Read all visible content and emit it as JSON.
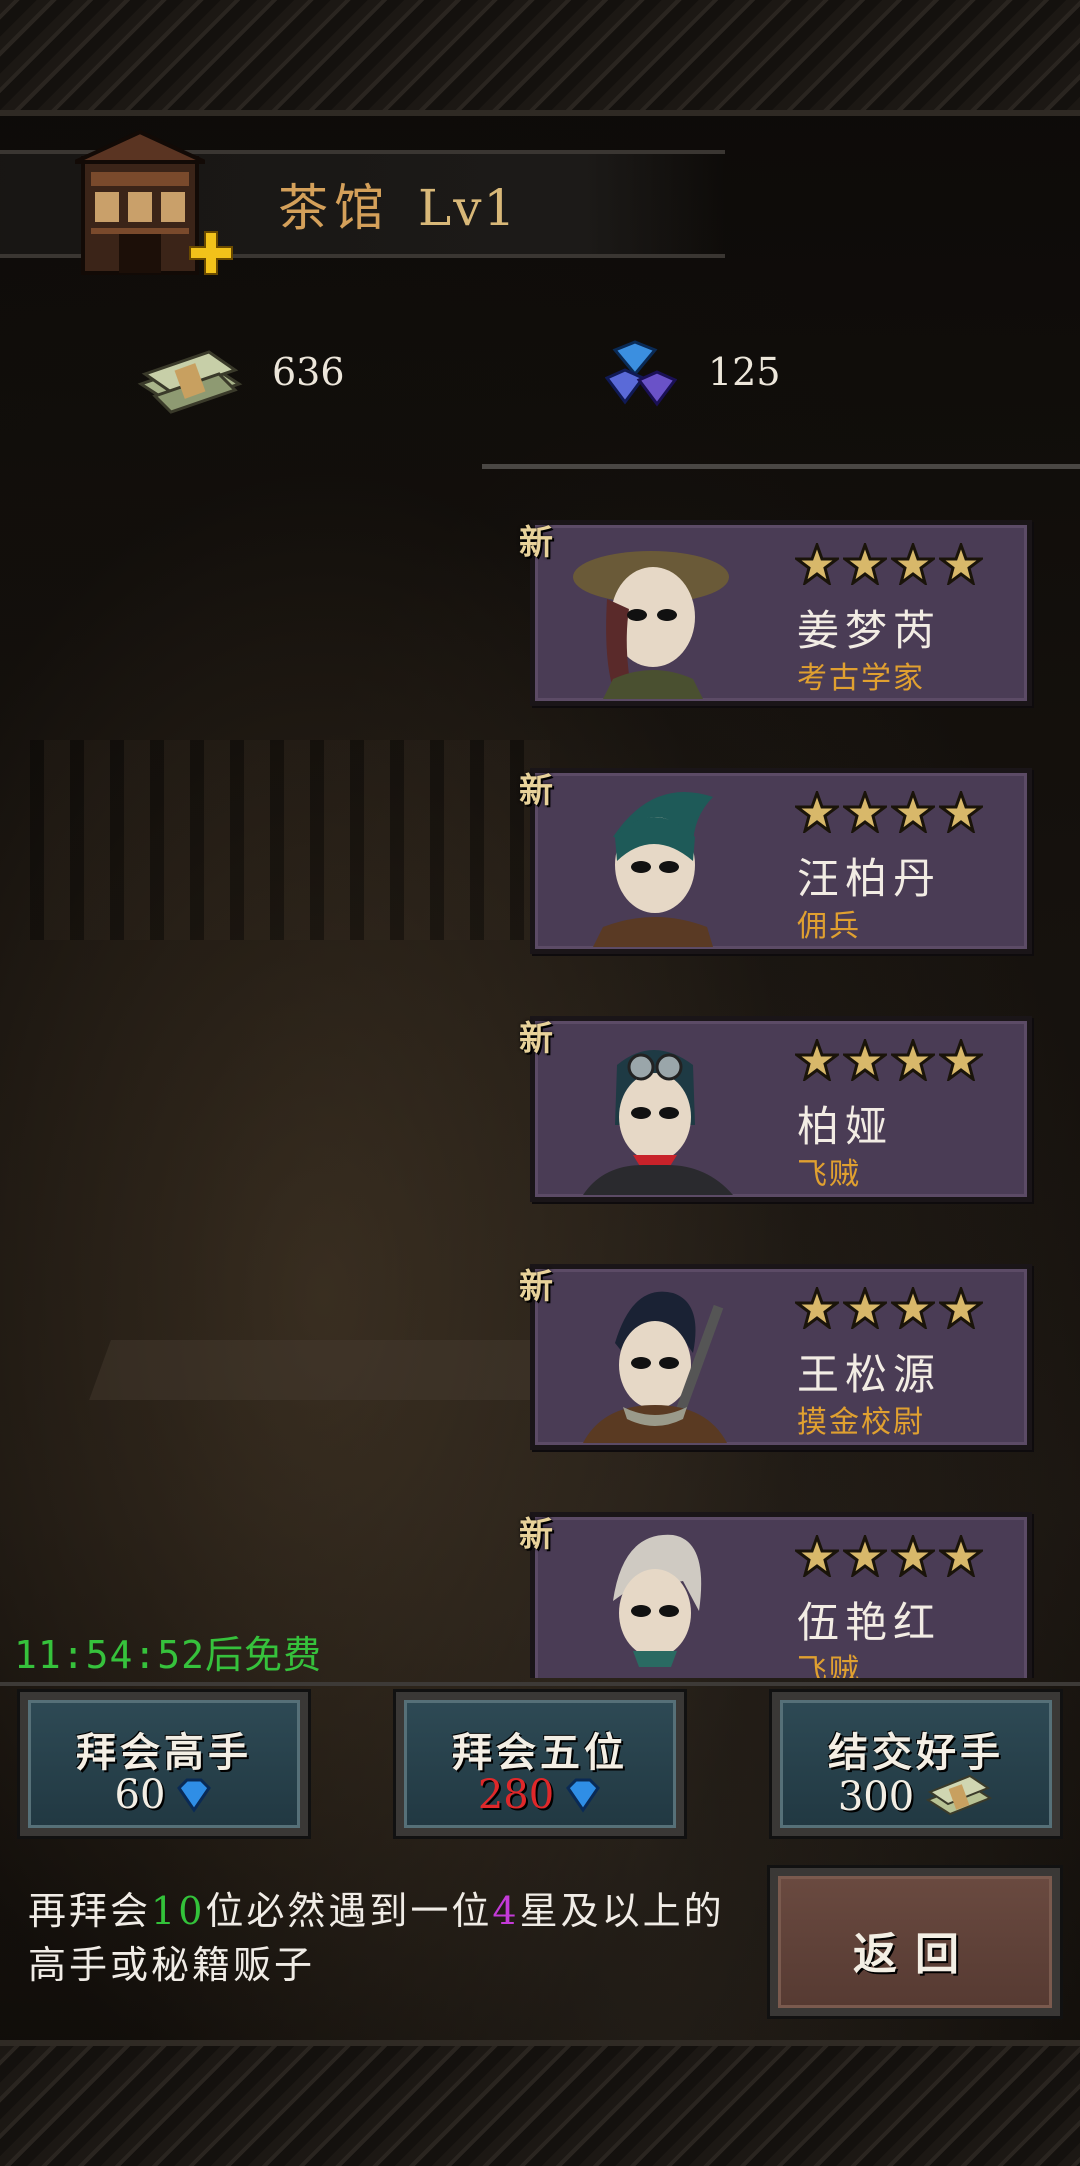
{
  "header": {
    "title": "茶馆",
    "level": "Lv1"
  },
  "currency": {
    "cash": "636",
    "gems": "125"
  },
  "recruit_list": [
    {
      "tag": "新",
      "stars": 4,
      "name": "姜梦芮",
      "role": "考古学家"
    },
    {
      "tag": "新",
      "stars": 4,
      "name": "汪柏丹",
      "role": "佣兵"
    },
    {
      "tag": "新",
      "stars": 4,
      "name": "柏娅",
      "role": "飞贼"
    },
    {
      "tag": "新",
      "stars": 4,
      "name": "王松源",
      "role": "摸金校尉"
    },
    {
      "tag": "新",
      "stars": 4,
      "name": "伍艳红",
      "role": "飞贼"
    }
  ],
  "free_timer": "11:54:52后免费",
  "actions": [
    {
      "label": "拜会高手",
      "cost": "60"
    },
    {
      "label": "拜会五位",
      "cost": "280"
    },
    {
      "label": "结交好手",
      "cost": "300"
    }
  ],
  "hint": {
    "part1": "再拜会",
    "count": "10",
    "part2": "位必然遇到一位",
    "stars": "4",
    "part3": "星及以上的高手或秘籍贩子"
  },
  "back_label": "返回",
  "colors": {
    "title": "#d4a05a",
    "timer": "#36c23c",
    "role": "#e0a030",
    "cost_warning": "#e0282a",
    "card": "#4a3c55"
  }
}
